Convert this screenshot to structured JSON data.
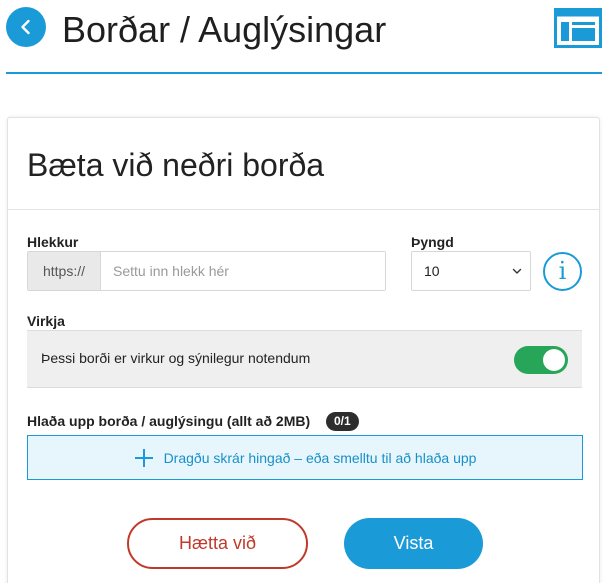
{
  "header": {
    "title": "Borðar / Auglýsingar",
    "back_icon": "chevron-left-icon",
    "layout_icon": "layout-icon",
    "accent_color": "#1a9bd7"
  },
  "card": {
    "title": "Bæta við neðri borða"
  },
  "link_field": {
    "label": "Hlekkur",
    "prefix": "https://",
    "value": "",
    "placeholder": "Settu inn hlekk hér"
  },
  "weight_field": {
    "label": "Þyngd",
    "selected": "10"
  },
  "info": {
    "icon": "info-icon",
    "glyph": "i"
  },
  "active_toggle": {
    "label": "Virkja",
    "description": "Þessi borði er virkur og sýnilegur notendum",
    "enabled": true,
    "on_color": "#27a559"
  },
  "upload": {
    "label": "Hlaða upp borða / auglýsingu (allt að 2MB)",
    "count": "0/1",
    "dropzone_text": "Dragðu skrár hingað – eða smelltu til að hlaða upp"
  },
  "actions": {
    "cancel_label": "Hætta við",
    "save_label": "Vista",
    "cancel_color": "#c0392b"
  }
}
